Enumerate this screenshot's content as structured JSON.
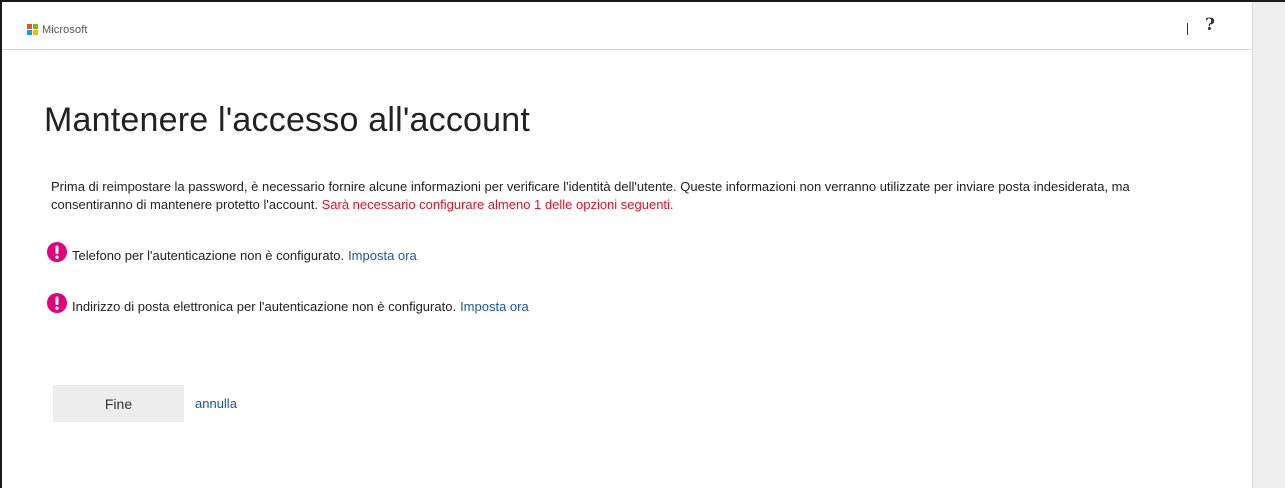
{
  "header": {
    "brand": "Microsoft",
    "help_symbol": "?"
  },
  "main": {
    "title": "Mantenere l'accesso all'account",
    "description": "Prima di reimpostare la password, è necessario fornire alcune informazioni per verificare l'identità dell'utente. Queste informazioni non verranno utilizzate per inviare posta indesiderata, ma consentiranno di mantenere protetto l'account.",
    "requirement_warning": "Sarà necessario configurare almeno 1 delle opzioni seguenti.",
    "items": [
      {
        "text": "Telefono per l'autenticazione non è configurato.",
        "link": "Imposta ora"
      },
      {
        "text": "Indirizzo di posta elettronica per l'autenticazione non è configurato.",
        "link": "Imposta ora"
      }
    ]
  },
  "actions": {
    "finish_label": "Fine",
    "cancel_label": "annulla"
  },
  "colors": {
    "warning_text": "#e81123",
    "link": "#1e56a6",
    "alert_icon": "#e3007b",
    "button_bg": "#ededed"
  },
  "icons": {
    "logo": "microsoft-logo-icon",
    "help": "help-icon",
    "alert": "exclamation-circle-icon"
  }
}
